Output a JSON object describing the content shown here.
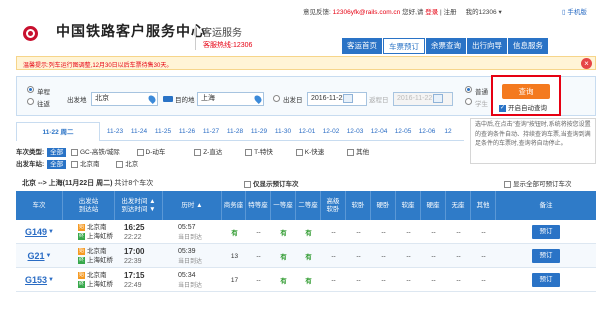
{
  "header": {
    "site_name": "中国铁路客户服务中心",
    "service_title": "客运服务",
    "hotline": "客服热线:12306",
    "top_links": {
      "feedback": "意见反馈:",
      "email": "12306yfk@rails.com.cn",
      "greeting": "您好,请",
      "login": "登录",
      "sep": "|",
      "register": "注册",
      "my12306": "我的12306 ▾",
      "mobile": "手机版"
    },
    "nav": [
      "客运首页",
      "车票预订",
      "余票查询",
      "出行向导",
      "信息服务"
    ],
    "nav_active": 1
  },
  "notice": {
    "text": "温馨提示:列车运行图调整,12月30日以后车票待售30天。",
    "close": "×"
  },
  "query": {
    "trip_type": [
      "单程",
      "往返"
    ],
    "from_label": "出发地",
    "from_value": "北京",
    "to_label": "目的地",
    "to_value": "上海",
    "date_label": "出发日",
    "date_value": "2016-11-22",
    "return_label": "返程日",
    "return_value": "2016-11-22",
    "passenger_type": [
      "普通",
      "学生"
    ],
    "query_button": "查询",
    "auto_query": "开启自动查询"
  },
  "dates": [
    "11-22 周二",
    "11-23",
    "11-24",
    "11-25",
    "11-26",
    "11-27",
    "11-28",
    "11-29",
    "11-30",
    "12-01",
    "12-02",
    "12-03",
    "12-04",
    "12-05",
    "12-06",
    "12"
  ],
  "tooltip": "选中后,在点击\"查询\"按钮时,系统将按您设置的查询条件自动、持续查询车票,当查询到满足条件的车票时,查询将自动停止。",
  "filters": {
    "type_label": "车次类型:",
    "all": "全部",
    "types": [
      "GC-高铁/城际",
      "D-动车",
      "Z-直达",
      "T-特快",
      "K-快速",
      "其他"
    ],
    "station_label": "出发车站:",
    "stations": [
      "北京南",
      "北京"
    ]
  },
  "summary": {
    "route": "北京 --> 上海(11月22日 周二)",
    "count": "共计8个车次",
    "only_bookable": "仅显示预订车次",
    "show_all": "显示全部可预订车次"
  },
  "table": {
    "headers": [
      "车次",
      "出发站\n到达站",
      "出发时间 ▲\n到达时间 ▼",
      "历时 ▲",
      "商务座",
      "特等座",
      "一等座",
      "二等座",
      "高级\n软卧",
      "软卧",
      "硬卧",
      "软座",
      "硬座",
      "无座",
      "其他",
      "备注"
    ],
    "rows": [
      {
        "train": "G149",
        "from": "北京南",
        "to": "上海虹桥",
        "dep": "16:25",
        "arr": "22:22",
        "dur": "05:57",
        "day": "当日到达",
        "seats": [
          "有",
          "--",
          "有",
          "有",
          "--",
          "--",
          "--",
          "--",
          "--",
          "--",
          "--"
        ],
        "book": "预订"
      },
      {
        "train": "G21",
        "from": "北京南",
        "to": "上海虹桥",
        "dep": "17:00",
        "arr": "22:39",
        "dur": "05:39",
        "day": "当日到达",
        "seats": [
          "13",
          "--",
          "有",
          "有",
          "--",
          "--",
          "--",
          "--",
          "--",
          "--",
          "--"
        ],
        "book": "预订"
      },
      {
        "train": "G153",
        "from": "北京南",
        "to": "上海虹桥",
        "dep": "17:15",
        "arr": "22:49",
        "dur": "05:34",
        "day": "当日到达",
        "seats": [
          "17",
          "--",
          "有",
          "有",
          "--",
          "--",
          "--",
          "--",
          "--",
          "--",
          "--"
        ],
        "book": "预订"
      }
    ]
  }
}
